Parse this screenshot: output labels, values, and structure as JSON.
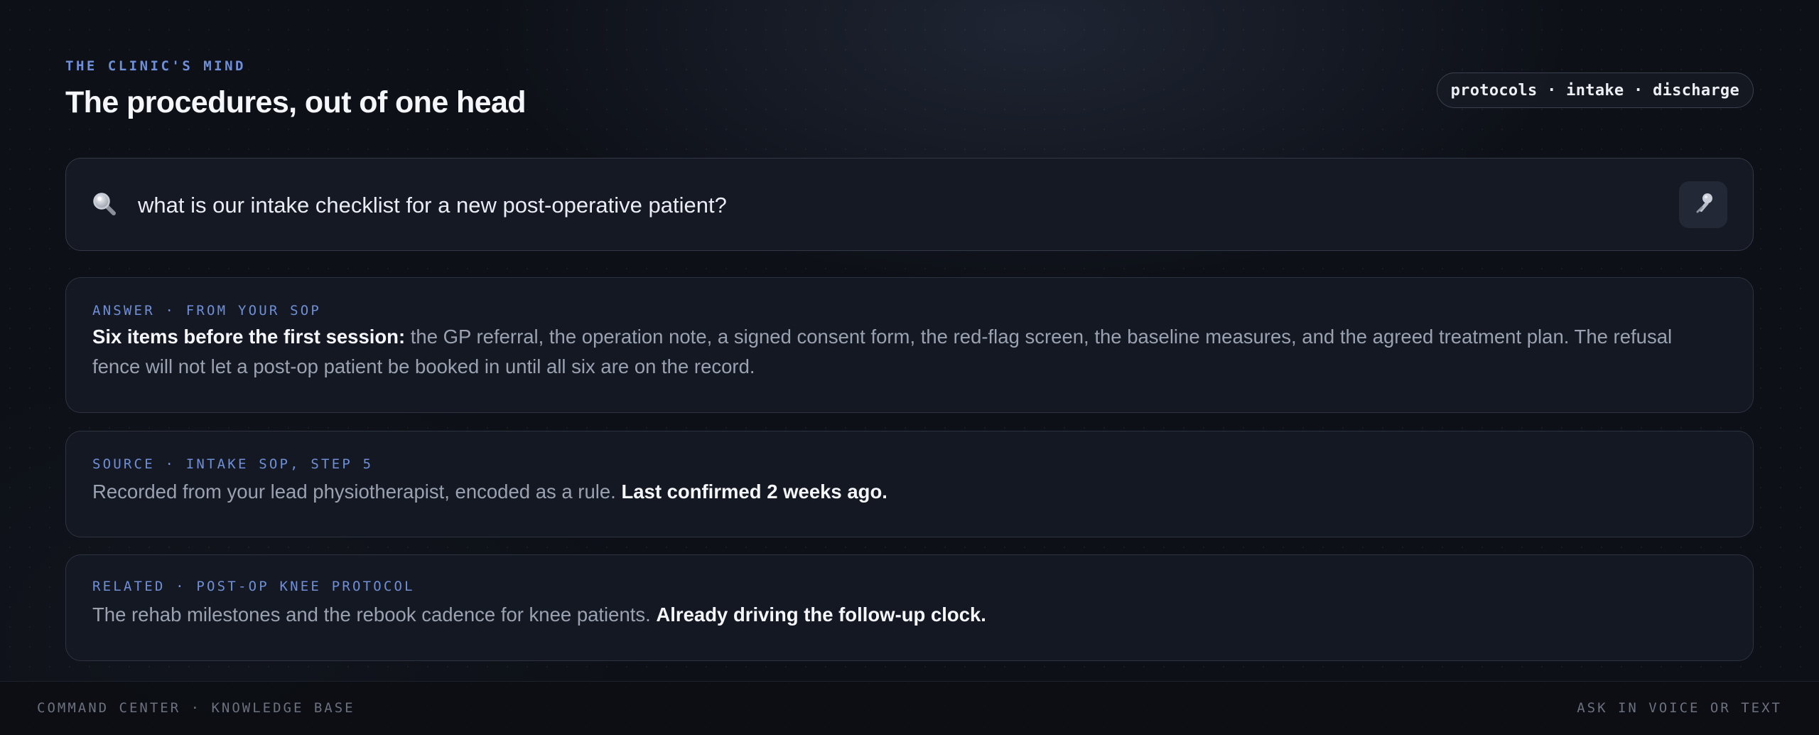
{
  "header": {
    "eyebrow": "THE CLINIC'S MIND",
    "title": "The procedures, out of one head",
    "scope": "protocols · intake · discharge"
  },
  "search": {
    "icon": "search-icon",
    "query": "what is our intake checklist for a new post-operative patient?",
    "mic_icon": "microphone-icon"
  },
  "answer": {
    "label": "ANSWER · FROM YOUR SOP",
    "lead": "Six items before the first session:",
    "body": " the GP referral, the operation note, a signed consent form, the red-flag screen, the baseline measures, and the agreed treatment plan. The refusal fence will not let a post-op patient be booked in until all six are on the record."
  },
  "source": {
    "label": "SOURCE · INTAKE SOP, STEP 5",
    "body": "Recorded from your lead physiotherapist, encoded as a rule. ",
    "emphasis": "Last confirmed 2 weeks ago."
  },
  "related": {
    "label": "RELATED · POST-OP KNEE PROTOCOL",
    "body": "The rehab milestones and the rebook cadence for knee patients. ",
    "emphasis": "Already driving the follow-up clock."
  },
  "footer": {
    "left": "COMMAND CENTER · KNOWLEDGE BASE",
    "right": "ASK IN VOICE OR TEXT"
  },
  "colors": {
    "background": "#0d1017",
    "accent": "#6f8fd8",
    "card": "#141822",
    "text_primary": "#f4f6fa",
    "text_muted": "#9aa2b1"
  }
}
